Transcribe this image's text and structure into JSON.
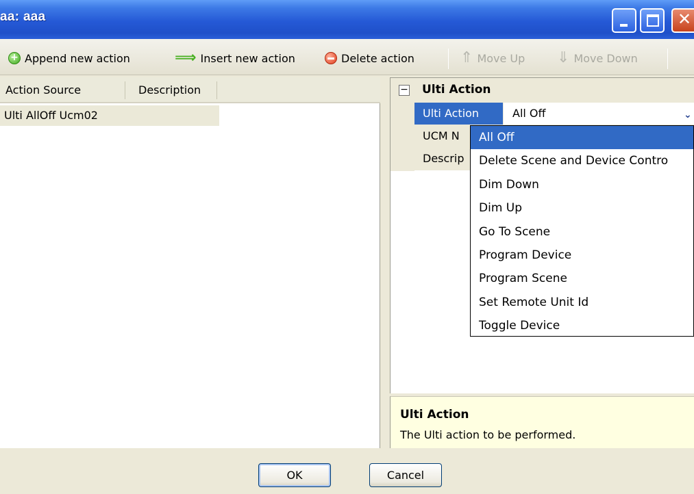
{
  "window": {
    "title": "aa: aaa"
  },
  "toolbar": {
    "append_label": "Append new action",
    "insert_label": "Insert new action",
    "delete_label": "Delete action",
    "move_up_label": "Move Up",
    "move_down_label": "Move Down"
  },
  "list": {
    "columns": [
      "Action Source",
      "Description"
    ],
    "rows": [
      {
        "action_source": "Ulti AllOff Ucm02",
        "description": ""
      }
    ]
  },
  "property_grid": {
    "category": "Ulti Action",
    "expander": "⊟",
    "rows": [
      {
        "name": "Ulti Action",
        "value": "All Off"
      },
      {
        "name": "UCM N",
        "value": ""
      },
      {
        "name": "Descrip",
        "value": ""
      }
    ]
  },
  "dropdown": {
    "options": [
      "All Off",
      "Delete Scene and Device Contro",
      "Dim Down",
      "Dim Up",
      "Go To Scene",
      "Program Device",
      "Program Scene",
      "Set Remote Unit Id",
      "Toggle Device"
    ],
    "selected": "All Off"
  },
  "help": {
    "title": "Ulti Action",
    "text": "The Ulti action to be performed."
  },
  "buttons": {
    "ok_label": "OK",
    "cancel_label": "Cancel"
  },
  "colors": {
    "titlebar": "#2559d6",
    "selection": "#316ac5",
    "help_background": "#ffffe1",
    "dialog_background": "#ece9d8"
  },
  "icons": {
    "append": "plus-circle-green-icon",
    "insert": "arrow-right-green-icon",
    "delete": "minus-circle-red-icon",
    "move_up": "arrow-up-icon",
    "move_down": "arrow-down-icon"
  }
}
